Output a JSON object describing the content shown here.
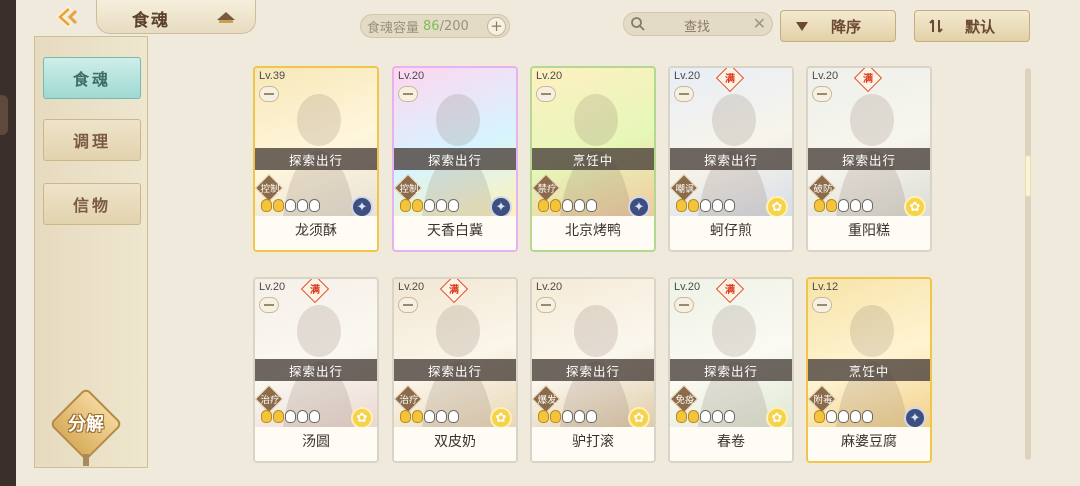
{
  "header": {
    "title": "食魂",
    "capacity_label": "食魂容量",
    "capacity_current": "86",
    "capacity_max": "/200",
    "add_label": "+",
    "search_label": "查找",
    "search_clear": "✕",
    "sort_order_label": "降序",
    "sort_mode_label": "默认"
  },
  "sidebar": {
    "tabs": [
      {
        "label": "食魂",
        "active": true
      },
      {
        "label": "调理",
        "active": false
      },
      {
        "label": "信物",
        "active": false
      }
    ],
    "decompose_label": "分解"
  },
  "cards": [
    {
      "level": "Lv.39",
      "full": false,
      "status": "探索出行",
      "role": "控制",
      "stars": 2,
      "medal": "blue",
      "name": "龙须酥",
      "border": "#f0c54a",
      "art": [
        "#f7e8b8",
        "#fff6dc",
        "#e8e2d6"
      ]
    },
    {
      "level": "Lv.20",
      "full": false,
      "status": "探索出行",
      "role": "控制",
      "stars": 2,
      "medal": "blue",
      "name": "天香白冀",
      "border": "#e8b2f0",
      "art": [
        "#ffd6ef",
        "#d6f4ff",
        "#fff2b8"
      ]
    },
    {
      "level": "Lv.20",
      "full": false,
      "status": "烹饪中",
      "role": "禁疗",
      "stars": 2,
      "medal": "blue",
      "name": "北京烤鸭",
      "border": "#b3d98f",
      "art": [
        "#fff0c2",
        "#e6f7b8",
        "#f2c9a0"
      ]
    },
    {
      "level": "Lv.20",
      "full": true,
      "full_label": "满",
      "status": "探索出行",
      "role": "嘲讽",
      "stars": 2,
      "medal": "gold",
      "name": "蚵仔煎",
      "border": "#d9d4c8",
      "art": [
        "#e8eef7",
        "#f7f4ea",
        "#d7dde8"
      ]
    },
    {
      "level": "Lv.20",
      "full": true,
      "full_label": "满",
      "status": "探索出行",
      "role": "破防",
      "stars": 2,
      "medal": "gold",
      "name": "重阳糕",
      "border": "#d9d4c8",
      "art": [
        "#eef0ea",
        "#f7f5ee",
        "#dcdcd4"
      ]
    },
    {
      "level": "Lv.20",
      "full": true,
      "full_label": "满",
      "status": "探索出行",
      "role": "治疗",
      "stars": 2,
      "medal": "gold",
      "name": "汤圆",
      "border": "#d9d4c8",
      "art": [
        "#f5efe8",
        "#fbf8f2",
        "#ead8d0"
      ]
    },
    {
      "level": "Lv.20",
      "full": true,
      "full_label": "满",
      "status": "探索出行",
      "role": "治疗",
      "stars": 2,
      "medal": "gold",
      "name": "双皮奶",
      "border": "#d9d4c8",
      "art": [
        "#f2e6d2",
        "#fbf6ea",
        "#e8d7b6"
      ]
    },
    {
      "level": "Lv.20",
      "full": false,
      "status": "探索出行",
      "role": "爆发",
      "stars": 2,
      "medal": "gold",
      "name": "驴打滚",
      "border": "#d9d4c8",
      "art": [
        "#f5ead6",
        "#fbf7ee",
        "#e0cba8"
      ]
    },
    {
      "level": "Lv.20",
      "full": true,
      "full_label": "满",
      "status": "探索出行",
      "role": "免疫",
      "stars": 2,
      "medal": "gold",
      "name": "春卷",
      "border": "#d9d4c8",
      "art": [
        "#eef2e6",
        "#fbfaf4",
        "#dfe8d4"
      ]
    },
    {
      "level": "Lv.12",
      "full": false,
      "status": "烹饪中",
      "role": "附毒",
      "stars": 1,
      "medal": "blue",
      "name": "麻婆豆腐",
      "border": "#f0c54a",
      "art": [
        "#f7e3a8",
        "#fff4d2",
        "#f2d08a"
      ]
    }
  ]
}
